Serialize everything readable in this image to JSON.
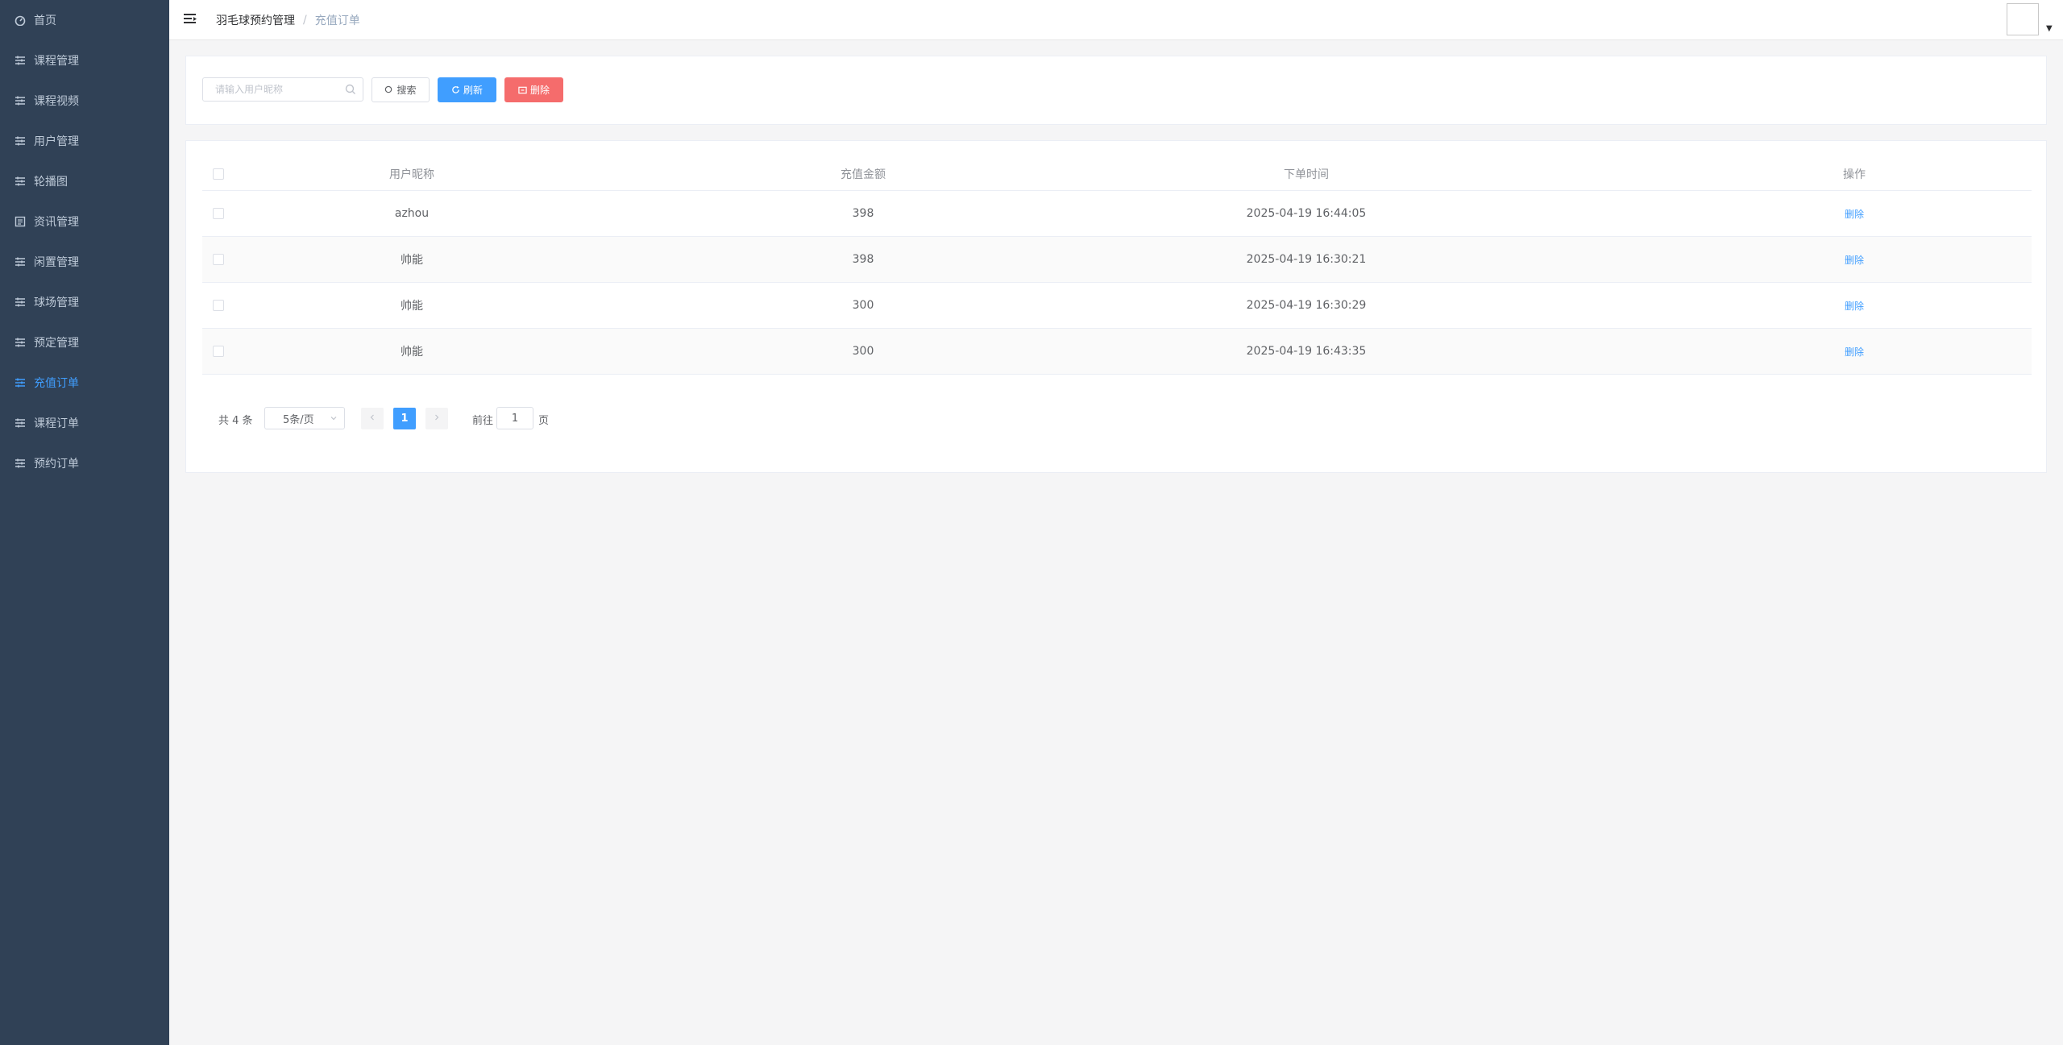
{
  "sidebar": {
    "items": [
      {
        "label": "首页",
        "icon": "dashboard-icon",
        "active": false
      },
      {
        "label": "课程管理",
        "icon": "sliders-icon",
        "active": false
      },
      {
        "label": "课程视频",
        "icon": "sliders-icon",
        "active": false
      },
      {
        "label": "用户管理",
        "icon": "sliders-icon",
        "active": false
      },
      {
        "label": "轮播图",
        "icon": "sliders-icon",
        "active": false
      },
      {
        "label": "资讯管理",
        "icon": "news-icon",
        "active": false
      },
      {
        "label": "闲置管理",
        "icon": "sliders-icon",
        "active": false
      },
      {
        "label": "球场管理",
        "icon": "sliders-icon",
        "active": false
      },
      {
        "label": "预定管理",
        "icon": "sliders-icon",
        "active": false
      },
      {
        "label": "充值订单",
        "icon": "sliders-icon",
        "active": true
      },
      {
        "label": "课程订单",
        "icon": "sliders-icon",
        "active": false
      },
      {
        "label": "预约订单",
        "icon": "sliders-icon",
        "active": false
      }
    ]
  },
  "header": {
    "breadcrumb": {
      "home": "羽毛球预约管理",
      "separator": "/",
      "current": "充值订单"
    }
  },
  "toolbar": {
    "search_placeholder": "请输入用户昵称",
    "search_label": "搜索",
    "refresh_label": "刷新",
    "delete_label": "删除"
  },
  "table": {
    "columns": {
      "nickname": "用户昵称",
      "amount": "充值金额",
      "time": "下单时间",
      "op": "操作"
    },
    "rows": [
      {
        "nickname": "azhou",
        "amount": "398",
        "time": "2025-04-19 16:44:05",
        "op": "删除"
      },
      {
        "nickname": "帅能",
        "amount": "398",
        "time": "2025-04-19 16:30:21",
        "op": "删除"
      },
      {
        "nickname": "帅能",
        "amount": "300",
        "time": "2025-04-19 16:30:29",
        "op": "删除"
      },
      {
        "nickname": "帅能",
        "amount": "300",
        "time": "2025-04-19 16:43:35",
        "op": "删除"
      }
    ]
  },
  "pagination": {
    "total": "共 4 条",
    "page_size": "5条/页",
    "current_page": "1",
    "goto": "前往",
    "goto_value": "1",
    "page_suffix": "页"
  },
  "colors": {
    "sidebar_bg": "#304156",
    "sidebar_text": "#bfcbd9",
    "active": "#409eff",
    "danger": "#f56c6c"
  }
}
